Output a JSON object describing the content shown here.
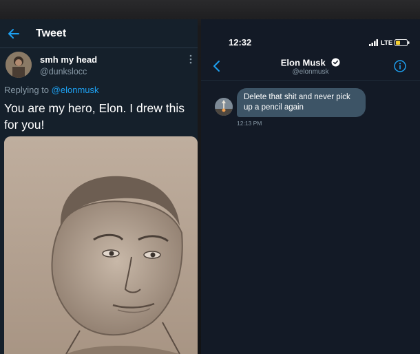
{
  "tweet_panel": {
    "header_title": "Tweet",
    "author": {
      "name": "smh my head",
      "handle": "@dunkslocc"
    },
    "replying_to_prefix": "Replying to",
    "replying_to_handle": "@elonmusk",
    "text": "You are my hero, Elon. I drew this for you!",
    "icons": {
      "back": "arrow-left-icon",
      "more": "more-vertical-icon"
    },
    "accent_color": "#1da1f2"
  },
  "dm_panel": {
    "status_bar": {
      "time": "12:32",
      "network": "LTE"
    },
    "contact": {
      "name": "Elon Musk",
      "handle": "@elonmusk",
      "verified": true
    },
    "messages": [
      {
        "text": "Delete that shit and never pick up a pencil again",
        "time": "12:13 PM",
        "direction": "incoming"
      }
    ],
    "icons": {
      "back": "chevron-left-icon",
      "info": "info-icon",
      "verified": "verified-badge-icon"
    },
    "accent_color": "#1da1f2"
  }
}
